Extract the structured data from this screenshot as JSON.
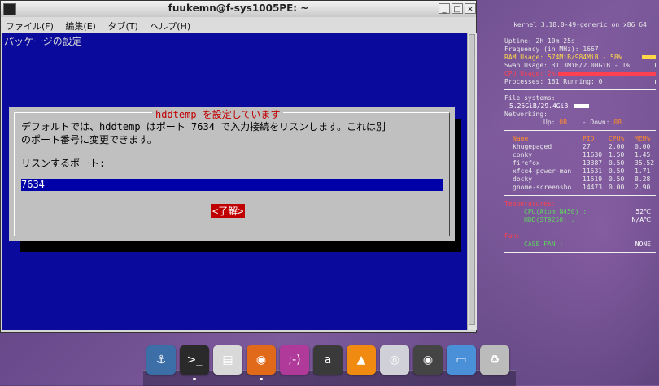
{
  "window": {
    "title": "fuukemn@f-sys1005PE: ~",
    "buttons": {
      "minimize": "_",
      "maximize": "□",
      "close": "×"
    },
    "menu": [
      "ファイル(F)",
      "編集(E)",
      "タブ(T)",
      "ヘルプ(H)"
    ]
  },
  "terminal": {
    "screen_title": "パッケージの設定",
    "dialog": {
      "title": "hddtemp を設定しています",
      "text_line1": "デフォルトでは、hddtemp はポート 7634 で入力接続をリスンします。これは別",
      "text_line2": "のポート番号に変更できます。",
      "prompt": "リスンするポート:",
      "input_value": "7634",
      "ok_label": "<了解>"
    }
  },
  "conky": {
    "kernel": "kernel 3.18.0-49-generic on x86_64",
    "uptime": "Uptime: 2h 10m 25s",
    "frequency": "Frequency (in MHz):   1667",
    "ram": "RAM Usage: 574MiB/984MiB - 58%",
    "ram_fraction": 0.58,
    "swap": "Swap Usage: 31.3MiB/2.00GiB - 1%",
    "swap_fraction": 0.01,
    "cpu": "CPU Usage: 2%",
    "cpu_fraction": 0.02,
    "processes": "Processes: 161  Running: 0",
    "fs_label": "File systems:",
    "fs_value": "5.25GiB/29.4GiB",
    "fs_fraction": 0.18,
    "net_label": "Networking:",
    "net_up_label": "Up:",
    "net_up": "0B",
    "net_down_label": "- Down:",
    "net_down": "0B",
    "proc_headers": [
      "Name",
      "PID",
      "CPU%",
      "MEM%"
    ],
    "processes_table": [
      [
        "khugepaged",
        "27",
        "2.00",
        "0.00"
      ],
      [
        "conky",
        "11630",
        "1.50",
        "1.45"
      ],
      [
        "firefox",
        "13387",
        "0.50",
        "35.52"
      ],
      [
        "xfce4-power-man",
        "11531",
        "0.50",
        "1.71"
      ],
      [
        "docky",
        "11519",
        "0.50",
        "8.28"
      ],
      [
        "gnome-screensho",
        "14473",
        "0.00",
        "2.90"
      ]
    ],
    "temp_header": "Temperatures:",
    "cpu_temp_label": "CPU(Atom N450) :",
    "cpu_temp": "52℃",
    "hdd_temp_label": "HDD(ST9250) :",
    "hdd_temp": "N/A℃",
    "fan_header": "Fan:",
    "fan_label": "CASE FAN  :",
    "fan_value": "NONE"
  },
  "dock": {
    "items": [
      {
        "name": "anchor-icon",
        "glyph": "⚓",
        "color": "#3c6ea8"
      },
      {
        "name": "terminal-icon",
        "glyph": ">_",
        "color": "#2a2a2a"
      },
      {
        "name": "file-cabinet-icon",
        "glyph": "▤",
        "color": "#d8d8d8"
      },
      {
        "name": "firefox-icon",
        "glyph": "◉",
        "color": "#e06a1a"
      },
      {
        "name": "chat-icon",
        "glyph": ";-)",
        "color": "#b03a9a"
      },
      {
        "name": "amazon-icon",
        "glyph": "a",
        "color": "#3a3a3a"
      },
      {
        "name": "vlc-icon",
        "glyph": "▲",
        "color": "#f08a10"
      },
      {
        "name": "disc-icon",
        "glyph": "◎",
        "color": "#d0d0d8"
      },
      {
        "name": "camera-icon",
        "glyph": "◉",
        "color": "#444"
      },
      {
        "name": "screen-icon",
        "glyph": "▭",
        "color": "#4a90d8"
      },
      {
        "name": "trash-icon",
        "glyph": "♻",
        "color": "#bbbbbb"
      }
    ]
  }
}
